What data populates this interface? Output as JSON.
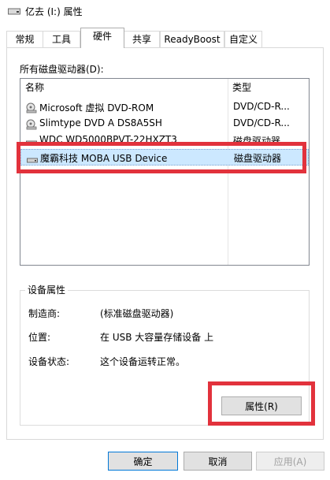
{
  "window": {
    "title": "亿去 (I:) 属性",
    "icon": "drive-icon"
  },
  "tabs": [
    {
      "label": "常规",
      "active": false
    },
    {
      "label": "工具",
      "active": false
    },
    {
      "label": "硬件",
      "active": true
    },
    {
      "label": "共享",
      "active": false
    },
    {
      "label": "ReadyBoost",
      "active": false
    },
    {
      "label": "自定义",
      "active": false
    }
  ],
  "hardware": {
    "all_drives_label": "所有磁盘驱动器(D):",
    "columns": {
      "name": "名称",
      "type": "类型"
    },
    "devices": [
      {
        "name": "Microsoft 虚拟 DVD-ROM",
        "type": "DVD/CD-R...",
        "icon": "dvd-drive-icon",
        "selected": false
      },
      {
        "name": "Slimtype DVD A  DS8A5SH",
        "type": "DVD/CD-R...",
        "icon": "dvd-drive-icon",
        "selected": false
      },
      {
        "name": "WDC WD5000BPVT-22HXZT3",
        "type": "磁盘驱动器",
        "icon": "hard-disk-icon",
        "selected": false
      },
      {
        "name": "魔霸科技 MOBA USB Device",
        "type": "磁盘驱动器",
        "icon": "usb-disk-icon",
        "selected": true
      }
    ]
  },
  "device_properties": {
    "group_title": "设备属性",
    "manufacturer_label": "制造商:",
    "manufacturer_value": "(标准磁盘驱动器)",
    "location_label": "位置:",
    "location_value": "在 USB 大容量存储设备 上",
    "status_label": "设备状态:",
    "status_value": "这个设备运转正常。",
    "properties_button": "属性(R)"
  },
  "footer": {
    "ok": "确定",
    "cancel": "取消",
    "apply": "应用(A)"
  },
  "colors": {
    "highlight": "#e2323c",
    "selection": "#cce8ff",
    "accent": "#0078d7"
  }
}
